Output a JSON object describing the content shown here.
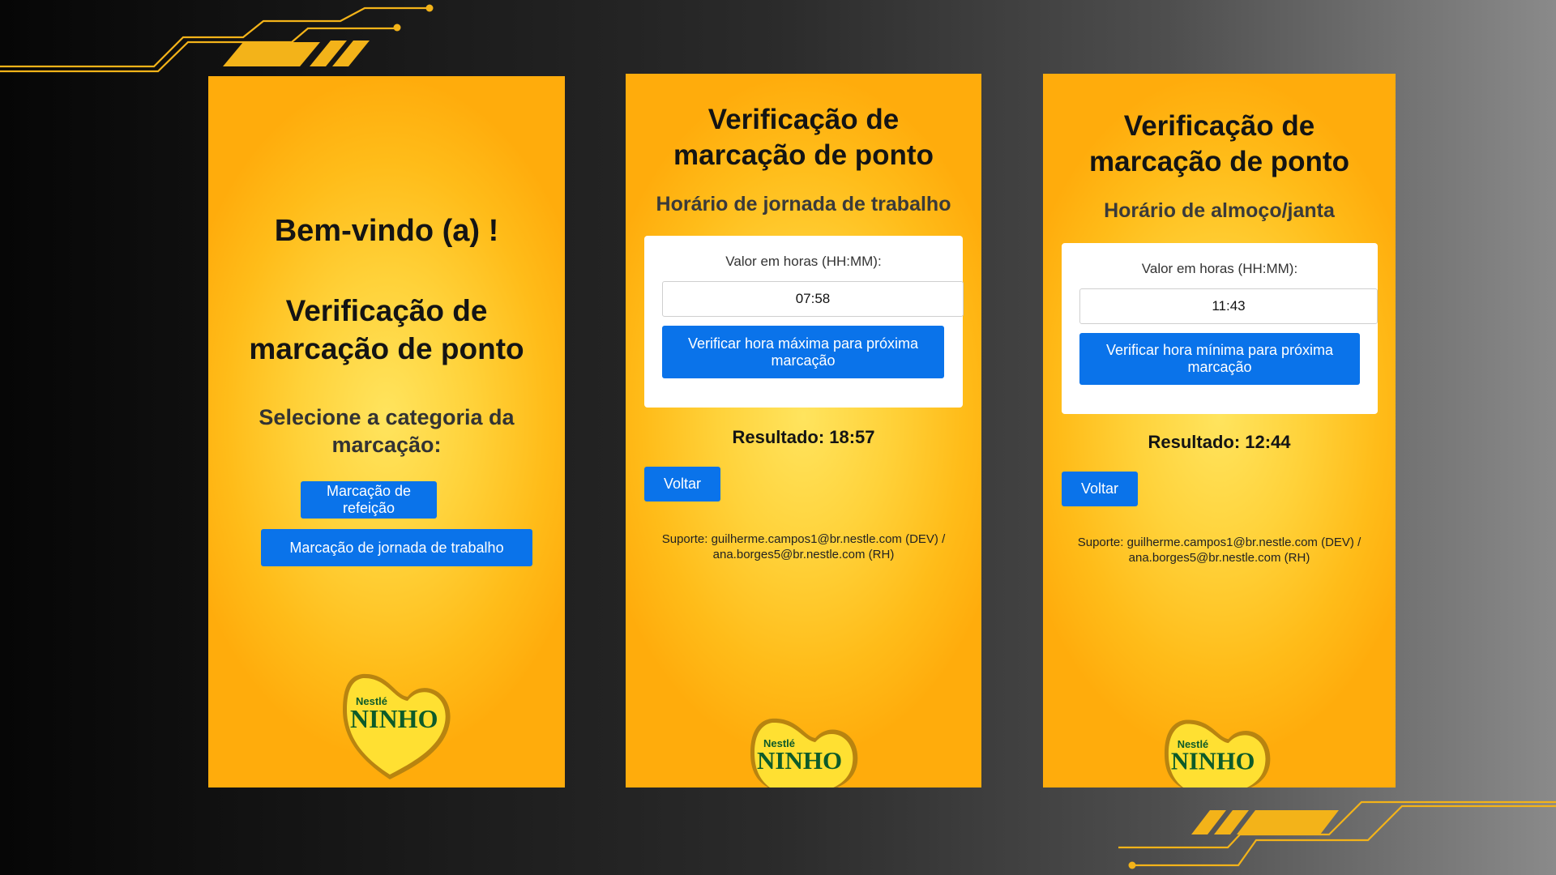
{
  "brand": {
    "logo_small": "Nestlé",
    "logo_main": "NINHO",
    "colors": {
      "accent_blue": "#0a73ea",
      "panel_yellow": "#ffc21f",
      "logo_green": "#0d5b2a"
    }
  },
  "welcome_screen": {
    "greeting": "Bem-vindo (a) !",
    "title_line1": "Verificação de",
    "title_line2": "marcação de ponto",
    "prompt_line1": "Selecione a categoria da",
    "prompt_line2": "marcação:",
    "meal_button": "Marcação de refeição",
    "workday_button": "Marcação de jornada de trabalho"
  },
  "workday_screen": {
    "title_line1": "Verificação de",
    "title_line2": "marcação de ponto",
    "subtitle": "Horário de jornada de trabalho",
    "input_label": "Valor em horas (HH:MM):",
    "input_value": "07:58",
    "verify_button": "Verificar hora máxima para próxima marcação",
    "result": "Resultado: 18:57",
    "back_button": "Voltar",
    "support_line1": "Suporte: guilherme.campos1@br.nestle.com (DEV) /",
    "support_line2": "ana.borges5@br.nestle.com (RH)"
  },
  "meal_screen": {
    "title_line1": "Verificação de",
    "title_line2": "marcação de ponto",
    "subtitle": "Horário de almoço/janta",
    "input_label": "Valor em horas (HH:MM):",
    "input_value": "11:43",
    "verify_button": "Verificar hora mínima para próxima marcação",
    "result": "Resultado: 12:44",
    "back_button": "Voltar",
    "support_line1": "Suporte: guilherme.campos1@br.nestle.com (DEV) /",
    "support_line2": "ana.borges5@br.nestle.com (RH)"
  }
}
